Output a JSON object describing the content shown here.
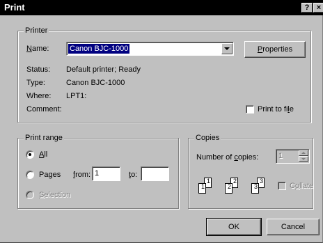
{
  "window": {
    "title": "Print",
    "help_label": "?",
    "close_label": "×"
  },
  "printer": {
    "group_label": "Printer",
    "name_label": "Name:",
    "name_value": "Canon BJC-1000",
    "properties_label": "Properties",
    "status_label": "Status:",
    "status_value": "Default printer; Ready",
    "type_label": "Type:",
    "type_value": "Canon BJC-1000",
    "where_label": "Where:",
    "where_value": "LPT1:",
    "comment_label": "Comment:",
    "print_to_file_label": "Print to file",
    "print_to_file_checked": false
  },
  "print_range": {
    "group_label": "Print range",
    "all_label": "All",
    "pages_label": "Pages",
    "from_label": "from:",
    "from_value": "1",
    "to_label": "to:",
    "to_value": "",
    "selection_label": "Selection",
    "selected": "All"
  },
  "copies": {
    "group_label": "Copies",
    "number_label": "Number of copies:",
    "number_value": "1",
    "collate_label": "Collate",
    "collate_checked": false,
    "page_labels": [
      "1",
      "1",
      "2",
      "2",
      "3",
      "3"
    ]
  },
  "buttons": {
    "ok_label": "OK",
    "cancel_label": "Cancel"
  }
}
